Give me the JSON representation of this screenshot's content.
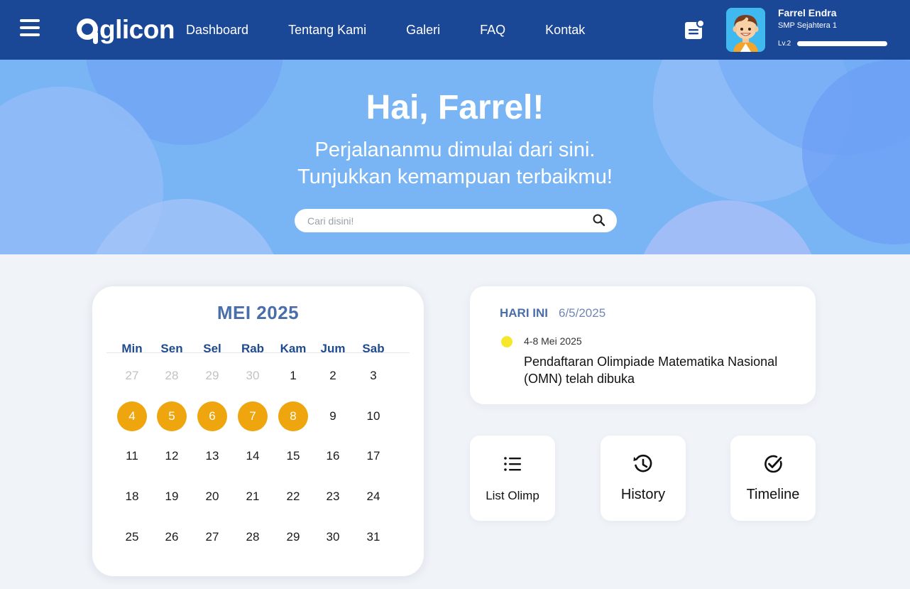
{
  "navbar": {
    "logo_text": "glicon",
    "links": [
      "Dashboard",
      "Tentang Kami",
      "Galeri",
      "FAQ",
      "Kontak"
    ],
    "profile": {
      "name": "Farrel Endra",
      "school": "SMP Sejahtera 1",
      "level": "Lv.2",
      "level_progress": 1.0
    },
    "icons": {
      "menu": "hamburger-icon",
      "notify": "notification-list-icon"
    }
  },
  "hero": {
    "title": "Hai, Farrel!",
    "subtitle_line1": "Perjalananmu dimulai dari sini.",
    "subtitle_line2": "Tunjukkan kemampuan terbaikmu!",
    "search_placeholder": "Cari disini!"
  },
  "calendar": {
    "title": "MEI 2025",
    "weekdays": [
      "Min",
      "Sen",
      "Sel",
      "Rab",
      "Kam",
      "Jum",
      "Sab"
    ],
    "weeks": [
      [
        "27",
        "28",
        "29",
        "30",
        "1",
        "2",
        "3"
      ],
      [
        "4",
        "5",
        "6",
        "7",
        "8",
        "9",
        "10"
      ],
      [
        "11",
        "12",
        "13",
        "14",
        "15",
        "16",
        "17"
      ],
      [
        "18",
        "19",
        "20",
        "21",
        "22",
        "23",
        "24"
      ],
      [
        "25",
        "26",
        "27",
        "28",
        "29",
        "30",
        "31"
      ]
    ],
    "muted_days_first_week": [
      "27",
      "28",
      "29",
      "30"
    ],
    "highlighted_days": [
      "4",
      "5",
      "6",
      "7",
      "8"
    ],
    "highlight_color": "#eea50e"
  },
  "today": {
    "label": "HARI INI",
    "date": "6/5/2025",
    "event_range": "4-8 Mei 2025",
    "event_title": "Pendaftaran Olimpiade Matematika Nasional (OMN) telah dibuka",
    "dot_color": "#f7e72a"
  },
  "actions": [
    {
      "label": "List Olimp",
      "icon": "list-icon"
    },
    {
      "label": "History",
      "icon": "history-icon"
    },
    {
      "label": "Timeline",
      "icon": "timeline-check-icon"
    }
  ],
  "colors": {
    "navbar": "#1b4797",
    "hero": "#79b5f5",
    "accent": "#4a6ea9"
  }
}
